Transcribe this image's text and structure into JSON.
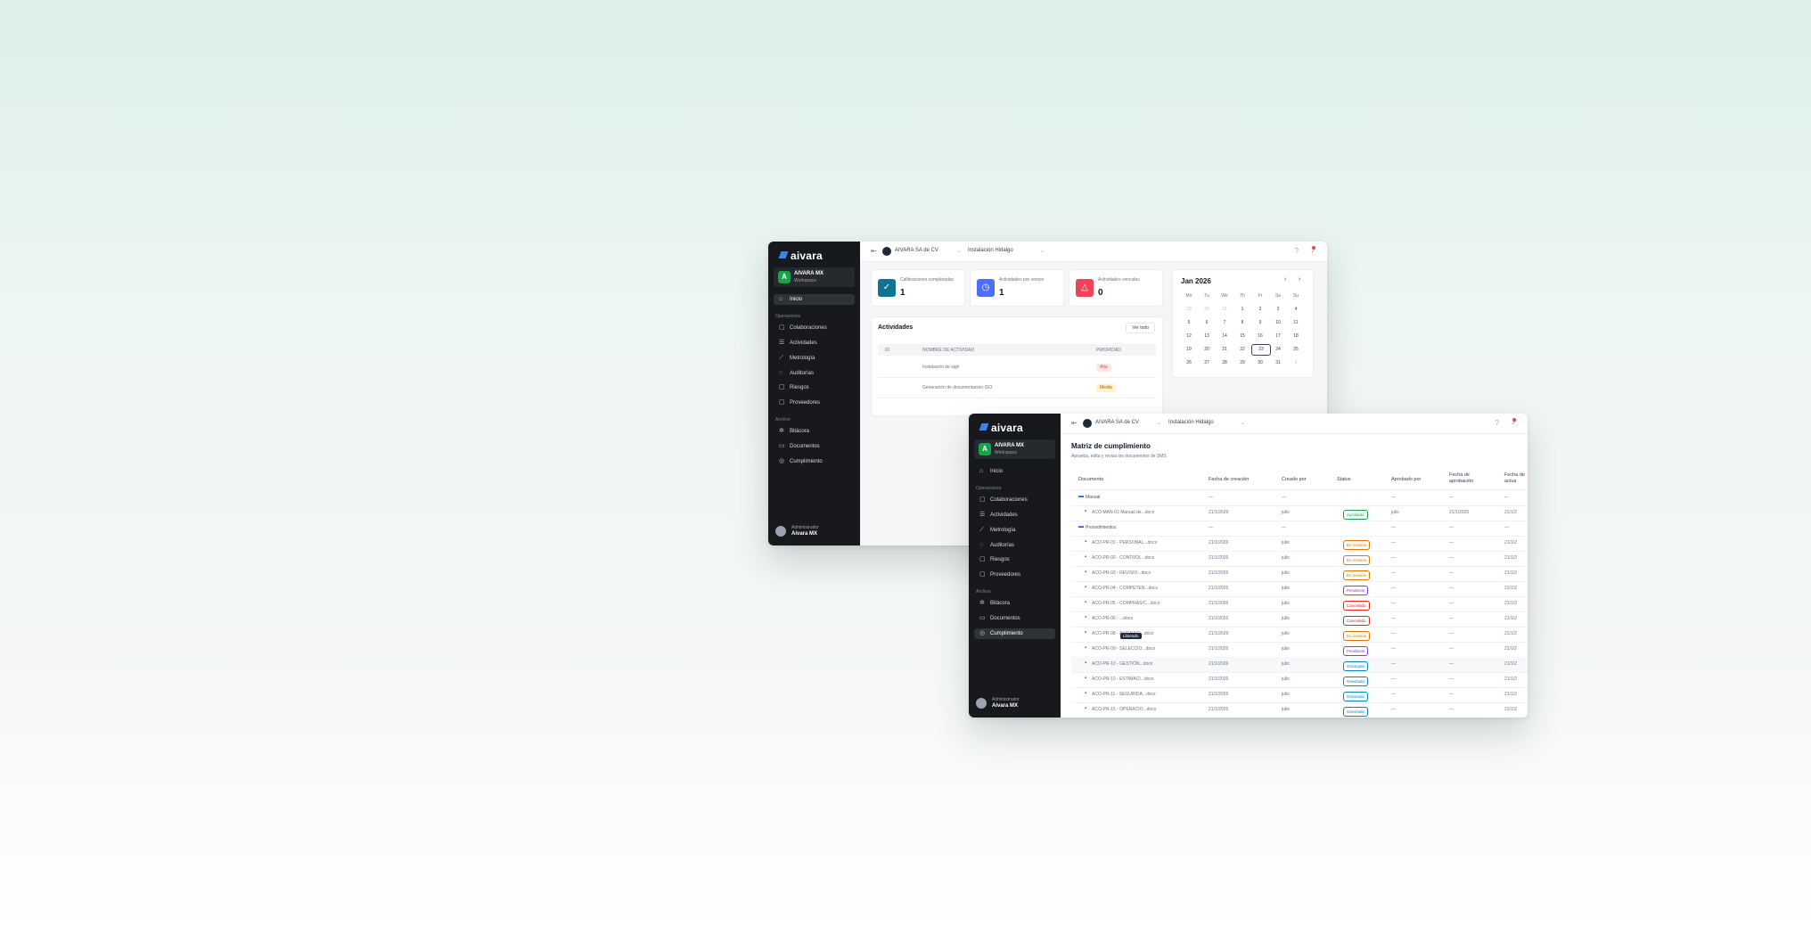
{
  "app": {
    "logo": "aivara"
  },
  "org": {
    "initial": "A",
    "name": "AIVARA MX",
    "subtitle": "Workspace"
  },
  "nav": {
    "inicio": "Inicio",
    "section_ops": "Operaciones",
    "colaboraciones": "Colaboraciones",
    "actividades": "Actividades",
    "metrologia": "Metrología",
    "auditorias": "Auditorías",
    "riesgos": "Riesgos",
    "proveedores": "Proveedores",
    "section_archivo": "Archivo",
    "bitacora": "Bitácora",
    "documentos": "Documentos",
    "cumplimiento": "Cumplimiento"
  },
  "user": {
    "role": "Administrador",
    "name": "Aivara MX"
  },
  "topbar": {
    "company": "AIVARA SA de CV",
    "plant": "Instalación Hidalgo"
  },
  "stats": [
    {
      "label": "Calibraciones completadas",
      "value": "1",
      "color": "#0e7490",
      "icon": "check-circle-icon"
    },
    {
      "label": "Actividades por vencer",
      "value": "1",
      "color": "#4f6ef7",
      "icon": "clock-icon"
    },
    {
      "label": "Actividades vencidas",
      "value": "0",
      "color": "#ef4456",
      "icon": "alert-triangle-icon"
    }
  ],
  "calendar": {
    "title": "Jan 2026",
    "weekdays": [
      "Mo",
      "Tu",
      "We",
      "Th",
      "Fr",
      "Sa",
      "Su"
    ],
    "weeks": [
      [
        "29",
        "30",
        "31",
        "1",
        "2",
        "3",
        "4"
      ],
      [
        "5",
        "6",
        "7",
        "8",
        "9",
        "10",
        "11"
      ],
      [
        "12",
        "13",
        "14",
        "15",
        "16",
        "17",
        "18"
      ],
      [
        "19",
        "20",
        "21",
        "22",
        "23",
        "24",
        "25"
      ],
      [
        "26",
        "27",
        "28",
        "29",
        "30",
        "31",
        "1"
      ]
    ],
    "today": "23"
  },
  "activities": {
    "title": "Actividades",
    "button": "Ver todo",
    "headers": [
      "ID",
      "NOMBRE DE ACTIVIDAD",
      "PRIORIDAD"
    ],
    "rows": [
      {
        "name": "Instalación de sign",
        "priority": "Alta",
        "color": "#ef4444",
        "bg": "#fde8e8"
      },
      {
        "name": "Generación de documentación ISO",
        "priority": "Media",
        "color": "#b45309",
        "bg": "#fef3c7"
      }
    ]
  },
  "compliance": {
    "title": "Matriz de cumplimiento",
    "subtitle": "Aprueba, edita y revisa los documentos de SMS",
    "headers": [
      "Documento",
      "Fecha de creación",
      "Creado por",
      "Status",
      "Aprobado por",
      "Fecha de aprobación",
      "Fecha de actua"
    ],
    "tooltip": "Liberado",
    "rows": [
      {
        "type": "folder",
        "name": "Manual",
        "c1": "—",
        "c2": "—",
        "status": "",
        "s_color": "",
        "c4": "—",
        "c5": "—",
        "c6": "—"
      },
      {
        "type": "file",
        "name": "ACO-MAN-01 Manual de...docx",
        "c1": "21/1/2026",
        "c2": "julio",
        "status": "Aprobado",
        "s_color": "#16a34a",
        "c4": "julio",
        "c5": "21/1/2026",
        "c6": "21/1/2"
      },
      {
        "type": "folder",
        "name": "Procedimientos",
        "c1": "—",
        "c2": "—",
        "status": "",
        "s_color": "",
        "c4": "—",
        "c5": "—",
        "c6": "—"
      },
      {
        "type": "file",
        "name": "ACO-PR-01 - PERSONAL...docx",
        "c1": "21/1/2026",
        "c2": "julio",
        "status": "En revisión",
        "s_color": "#d97706",
        "c4": "—",
        "c5": "—",
        "c6": "21/1/2"
      },
      {
        "type": "file",
        "name": "ACO-PR-02 - CONTROL...docx",
        "c1": "21/1/2026",
        "c2": "julio",
        "status": "En revisión",
        "s_color": "#d97706",
        "c4": "—",
        "c5": "—",
        "c6": "21/1/2"
      },
      {
        "type": "file",
        "name": "ACO-PR-03 - REVISIO...docx",
        "c1": "21/1/2026",
        "c2": "julio",
        "status": "En revisión",
        "s_color": "#d97706",
        "c4": "—",
        "c5": "—",
        "c6": "21/1/2"
      },
      {
        "type": "file",
        "name": "ACO-PR-04 - COMPETEN...docx",
        "c1": "21/1/2026",
        "c2": "julio",
        "status": "Pendiente",
        "s_color": "#9333ea",
        "c4": "—",
        "c5": "—",
        "c6": "21/1/2"
      },
      {
        "type": "file",
        "name": "ACO-PR-05 - COMPRAS/C...docx",
        "c1": "21/1/2026",
        "c2": "julio",
        "status": "Cancelado",
        "s_color": "#dc2626",
        "c4": "—",
        "c5": "—",
        "c6": "21/1/2"
      },
      {
        "type": "file",
        "name": "ACO-PR-06 - ...docx",
        "c1": "21/1/2026",
        "c2": "julio",
        "status": "Cancelado",
        "s_color": "#dc2626",
        "c4": "—",
        "c5": "—",
        "c6": "21/1/2"
      },
      {
        "type": "file",
        "name": "ACO-PR-08 - ASIGNACI...docx",
        "c1": "21/1/2026",
        "c2": "julio",
        "status": "En revisión",
        "s_color": "#d97706",
        "c4": "—",
        "c5": "—",
        "c6": "21/1/2"
      },
      {
        "type": "file",
        "name": "ACO-PR-09 - SELECCIO...docx",
        "c1": "21/1/2026",
        "c2": "julio",
        "status": "Pendiente",
        "s_color": "#9333ea",
        "c4": "—",
        "c5": "—",
        "c6": "21/1/2"
      },
      {
        "type": "file",
        "name": "ACO-PR-10 - GESTIÓN...docx",
        "c1": "21/1/2026",
        "c2": "julio",
        "status": "Generado",
        "s_color": "#0284c7",
        "c4": "—",
        "c5": "—",
        "c6": "21/1/2"
      },
      {
        "type": "file",
        "name": "ACO-PR-10 - ESTIMACI...docx",
        "c1": "21/1/2026",
        "c2": "julio",
        "status": "Generado",
        "s_color": "#0284c7",
        "c4": "—",
        "c5": "—",
        "c6": "21/1/2"
      },
      {
        "type": "file",
        "name": "ACO-PR-11 - SEGURIDA...docx",
        "c1": "21/1/2026",
        "c2": "julio",
        "status": "Generado",
        "s_color": "#0284c7",
        "c4": "—",
        "c5": "—",
        "c6": "21/1/2"
      },
      {
        "type": "file",
        "name": "ACO-PR-15 - OPERACIO...docx",
        "c1": "21/1/2026",
        "c2": "julio",
        "status": "Generado",
        "s_color": "#0284c7",
        "c4": "—",
        "c5": "—",
        "c6": "21/1/2"
      }
    ]
  }
}
